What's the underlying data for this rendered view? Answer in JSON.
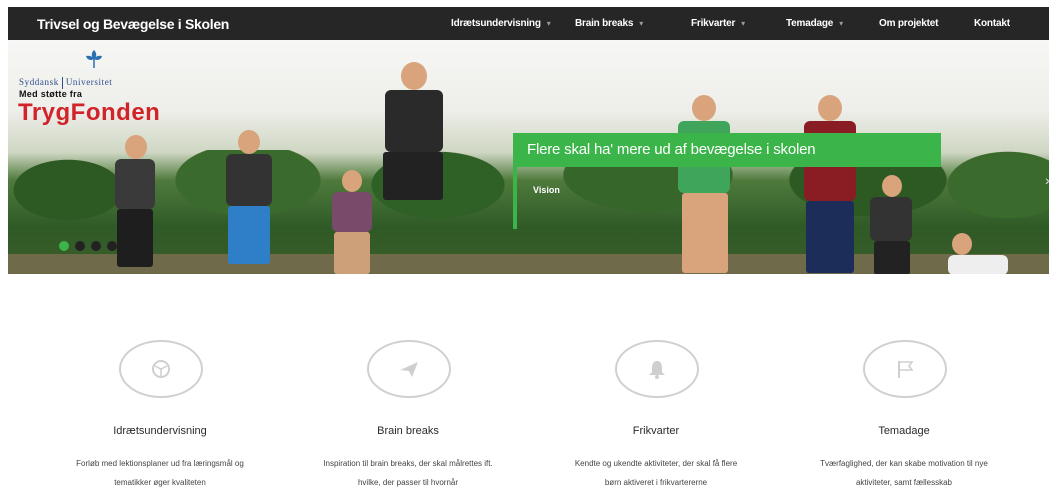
{
  "header": {
    "brand": "Trivsel og Bevægelse i Skolen",
    "nav": [
      {
        "label": "Idrætsundervisning",
        "dropdown": true
      },
      {
        "label": "Brain breaks",
        "dropdown": true
      },
      {
        "label": "Frikvarter",
        "dropdown": true
      },
      {
        "label": "Temadage",
        "dropdown": true
      },
      {
        "label": "Om projektet",
        "dropdown": false
      },
      {
        "label": "Kontakt",
        "dropdown": false
      }
    ]
  },
  "hero": {
    "university_left": "Syddansk",
    "university_right": "Universitet",
    "support_text": "Med støtte fra",
    "sponsor": "TrygFonden",
    "slide_title": "Flere skal ha' mere ud af bevægelse i skolen",
    "slide_tag": "Vision",
    "slide_count": 4,
    "active_slide": 1
  },
  "features": [
    {
      "icon": "football-icon",
      "title": "Idrætsundervisning",
      "desc_line1": "Forløb med lektionsplaner ud fra læringsmål og",
      "desc_line2": "tematikker øger kvaliteten"
    },
    {
      "icon": "paper-plane-icon",
      "title": "Brain breaks",
      "desc_line1": "Inspiration til brain breaks, der skal målrettes ift.",
      "desc_line2": "hvilke, der passer til hvornår"
    },
    {
      "icon": "bell-icon",
      "title": "Frikvarter",
      "desc_line1": "Kendte og ukendte aktiviteter, der skal få flere",
      "desc_line2": "børn aktiveret i frikvartererne"
    },
    {
      "icon": "flag-icon",
      "title": "Temadage",
      "desc_line1": "Tværfaglighed, der kan skabe motivation til nye",
      "desc_line2": "aktiviteter, samt fællesskab"
    }
  ],
  "colors": {
    "accent": "#3bb54a",
    "topbar": "#262626",
    "sponsor": "#d2232a",
    "university": "#2b4c8c"
  }
}
